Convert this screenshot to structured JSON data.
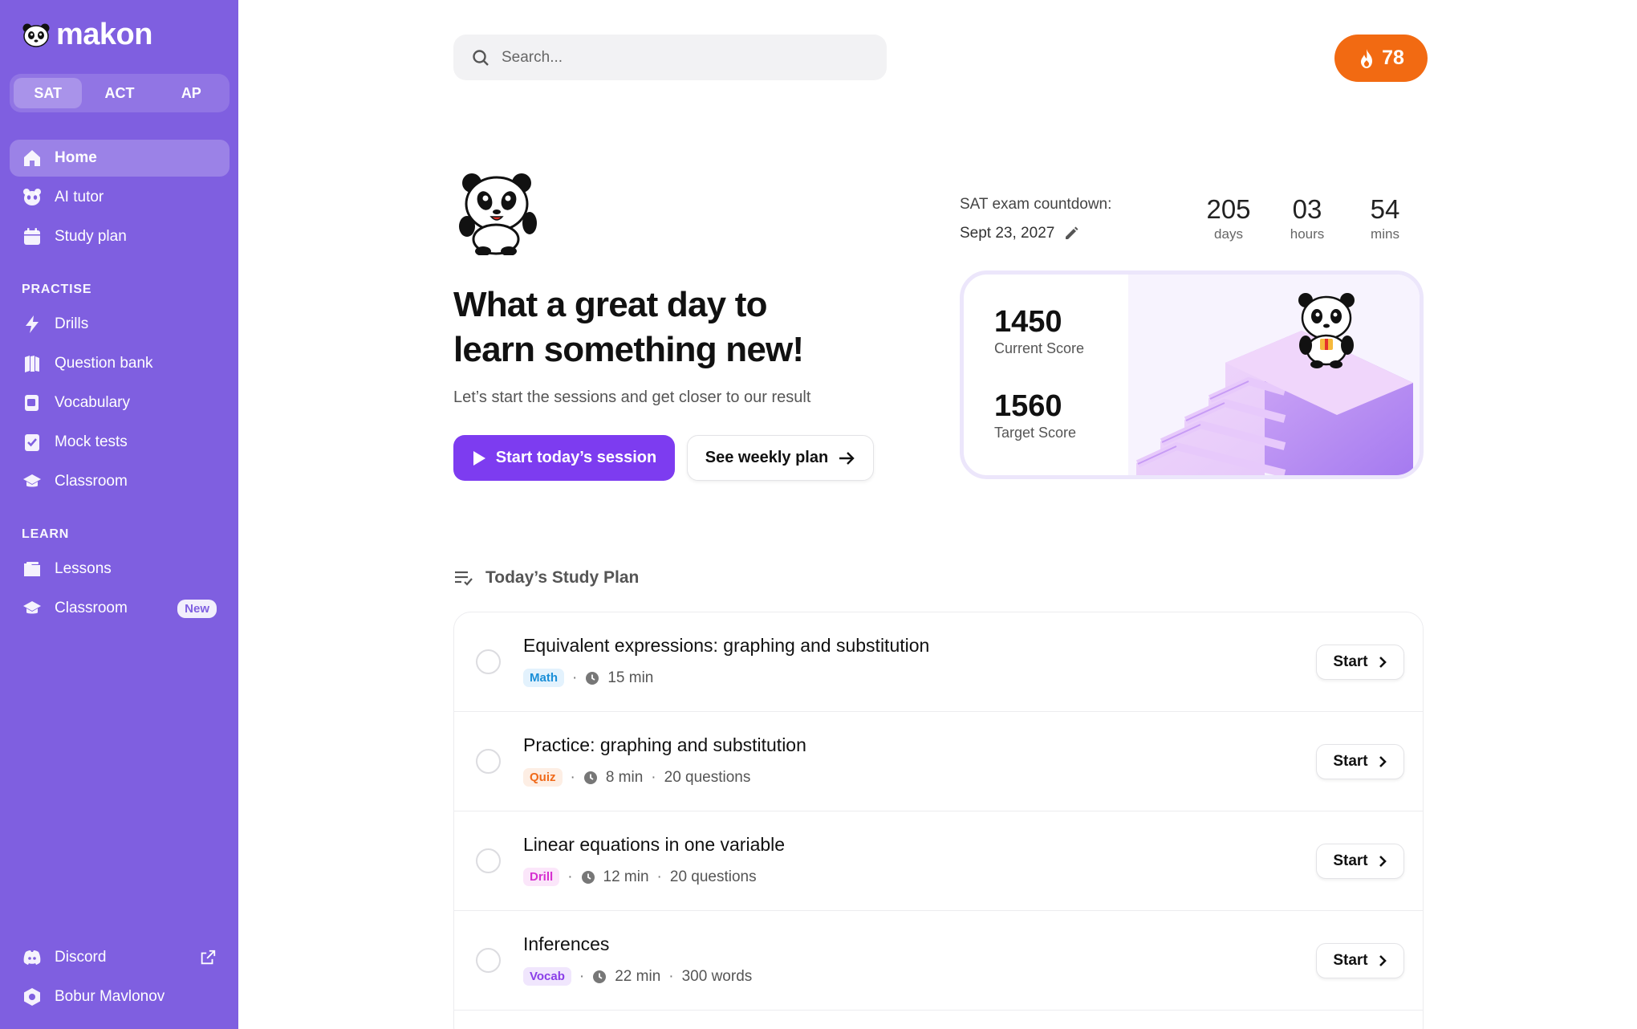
{
  "brand": {
    "name": "makon"
  },
  "exam_tabs": [
    {
      "label": "SAT",
      "active": true
    },
    {
      "label": "ACT",
      "active": false
    },
    {
      "label": "AP",
      "active": false
    }
  ],
  "nav": {
    "main": [
      {
        "label": "Home",
        "icon": "home-icon",
        "active": true
      },
      {
        "label": "AI tutor",
        "icon": "panda-face-icon"
      },
      {
        "label": "Study plan",
        "icon": "calendar-icon"
      }
    ],
    "practise_label": "PRACTISE",
    "practise": [
      {
        "label": "Drills",
        "icon": "lightning-icon"
      },
      {
        "label": "Question bank",
        "icon": "book-stack-icon"
      },
      {
        "label": "Vocabulary",
        "icon": "vocab-card-icon"
      },
      {
        "label": "Mock tests",
        "icon": "checklist-icon"
      },
      {
        "label": "Classroom",
        "icon": "graduation-cap-icon"
      }
    ],
    "learn_label": "LEARN",
    "learn": [
      {
        "label": "Lessons",
        "icon": "folder-icon"
      },
      {
        "label": "Classroom",
        "icon": "graduation-cap-icon",
        "badge": "New"
      }
    ],
    "bottom": [
      {
        "label": "Discord",
        "icon": "discord-icon",
        "external": true
      },
      {
        "label": "Bobur Mavlonov",
        "icon": "profile-hex-icon"
      }
    ]
  },
  "search": {
    "placeholder": "Search..."
  },
  "streak": {
    "count": "78",
    "icon": "flame-icon",
    "color": "#f26a12"
  },
  "hero": {
    "title_line1": "What a great day to",
    "title_line2": "learn something new!",
    "subtitle": "Let’s start the sessions and get closer to our result",
    "primary_label": "Start today’s session",
    "secondary_label": "See weekly plan"
  },
  "countdown": {
    "label": "SAT exam countdown:",
    "date": "Sept 23, 2027",
    "units": [
      {
        "value": "205",
        "caption": "days"
      },
      {
        "value": "03",
        "caption": "hours"
      },
      {
        "value": "54",
        "caption": "mins"
      }
    ]
  },
  "scores": {
    "current_value": "1450",
    "current_label": "Current Score",
    "target_value": "1560",
    "target_label": "Target Score"
  },
  "study_plan": {
    "heading": "Today’s Study Plan",
    "start_label": "Start",
    "items": [
      {
        "title": "Equivalent expressions: graphing and substitution",
        "tag": "Math",
        "duration": "15 min",
        "extra": ""
      },
      {
        "title": "Practice: graphing and substitution",
        "tag": "Quiz",
        "duration": "8 min",
        "extra": "20 questions"
      },
      {
        "title": "Linear equations in one variable",
        "tag": "Drill",
        "duration": "12 min",
        "extra": "20 questions"
      },
      {
        "title": "Inferences",
        "tag": "Vocab",
        "duration": "22 min",
        "extra": "300 words"
      }
    ]
  },
  "colors": {
    "sidebar": "#7f5fe0",
    "primary": "#7d3cf0",
    "tag_math": "#1a8fd8",
    "tag_quiz": "#f06a1a",
    "tag_drill": "#d62fd0",
    "tag_vocab": "#8a3ee8"
  }
}
